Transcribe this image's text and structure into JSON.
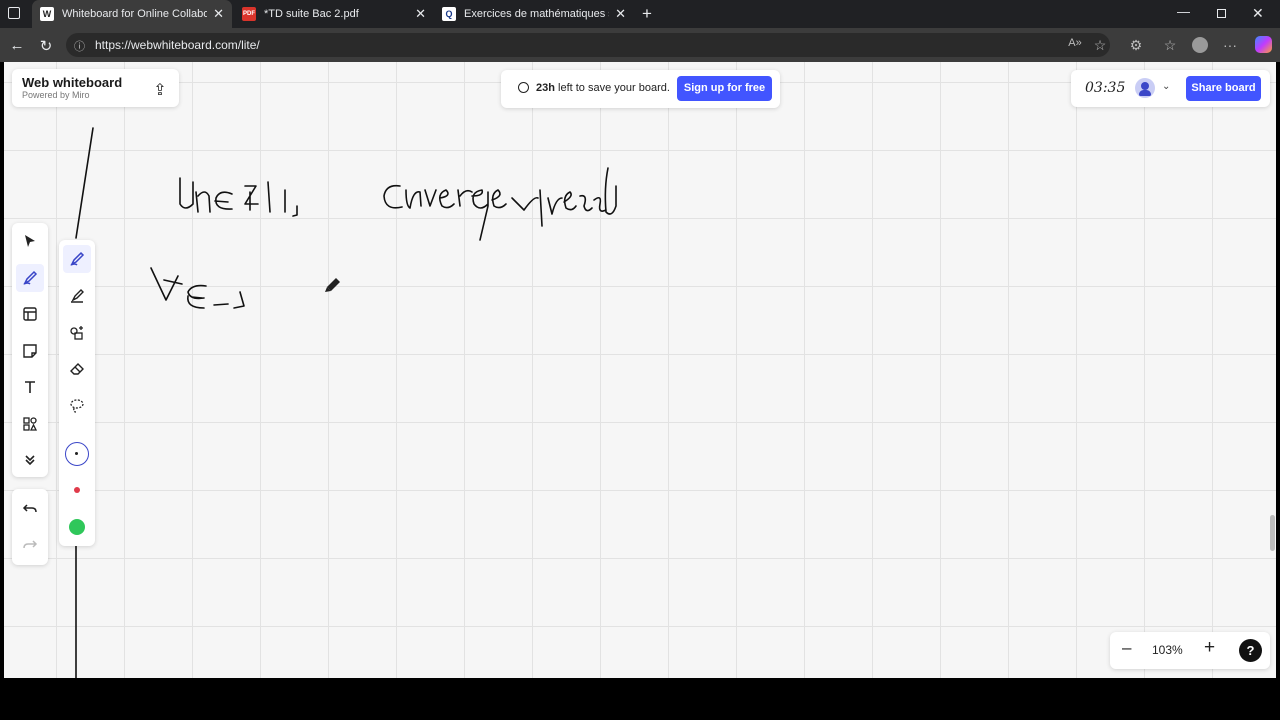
{
  "browser": {
    "tabs": [
      {
        "title": "Whiteboard for Online Collaborat",
        "favicon": "W",
        "active": true
      },
      {
        "title": "*TD suite Bac 2.pdf",
        "favicon": "PDF",
        "active": false
      },
      {
        "title": "Exercices de mathématiques supé",
        "favicon": "Q",
        "active": false
      }
    ],
    "url": "https://webwhiteboard.com/lite/"
  },
  "header": {
    "brand_title": "Web whiteboard",
    "brand_subtitle": "Powered by Miro",
    "notice_time": "23h",
    "notice_text": " left to save your board.",
    "signup_label": "Sign up for free",
    "share_label": "Share board",
    "timer_text": "03:35"
  },
  "zoom": {
    "minus": "–",
    "level": "103%",
    "plus": "+",
    "help": "?"
  },
  "colors": {
    "accent": "#4255ff",
    "brand_blue": "#3a46c8",
    "swatch_red": "#e03a4a",
    "swatch_green": "#2fc75a"
  },
  "tools_main": [
    "select-icon",
    "pen-icon",
    "frame-icon",
    "sticky-note-icon",
    "text-icon",
    "shapes-icon",
    "more-chevron-icon"
  ],
  "tools_pen": [
    "pen-icon",
    "highlighter-icon",
    "shape-pen-icon",
    "eraser-icon",
    "lasso-icon"
  ]
}
